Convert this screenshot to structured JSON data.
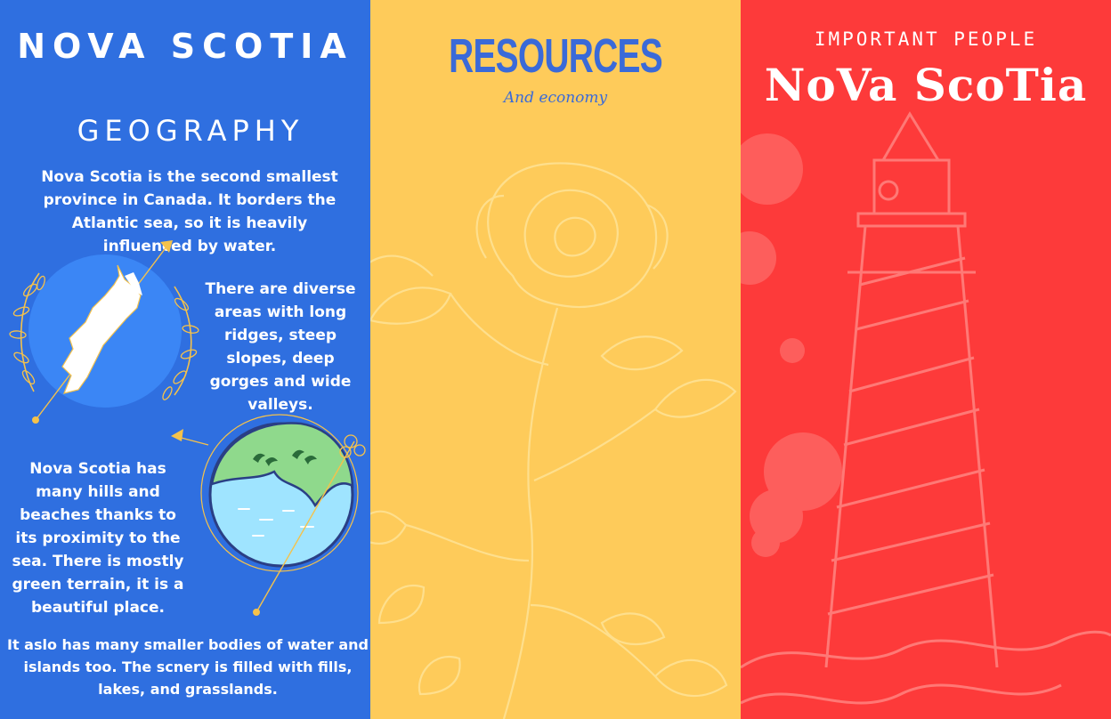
{
  "colors": {
    "panel_blue": "#2f6fe0",
    "panel_yellow": "#fecb5a",
    "panel_red": "#fd3a3a",
    "accent_gold": "#f5c24b",
    "title_blue": "#3a6ad8"
  },
  "geography": {
    "title": "NOVA SCOTIA",
    "subtitle": "GEOGRAPHY",
    "paragraph_1": "Nova Scotia is the second smallest province in Canada. It borders the Atlantic sea, so it is heavily influenced by water.",
    "paragraph_2": "There are diverse areas with long ridges, steep slopes, deep gorges and wide valleys.",
    "paragraph_3": "Nova Scotia has many hills and beaches thanks to its proximity to the sea. There is mostly green terrain, it is a beautiful place.",
    "paragraph_4": "It aslo has many smaller bodies of water and islands too. The scnery is filled with fills, lakes, and grasslands.",
    "icons": [
      "nova-scotia-map-icon",
      "coastline-globe-icon",
      "laurel-icon",
      "arrow-icon"
    ]
  },
  "resources": {
    "title": "RESOURCES",
    "subtitle": "And economy",
    "icons": [
      "rose-illustration"
    ]
  },
  "people": {
    "kicker": "IMPORTANT PEOPLE",
    "title": "NoVa ScoTia",
    "icons": [
      "lighthouse-illustration"
    ]
  }
}
